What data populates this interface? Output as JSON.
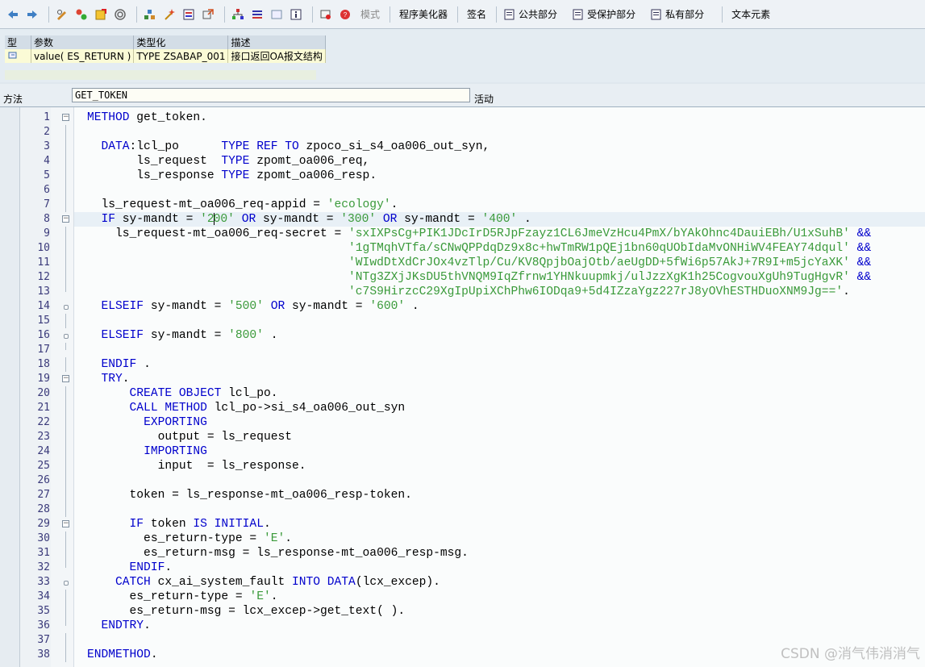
{
  "toolbar": {
    "mode_label": "模式",
    "pretty_printer_label": "程序美化器",
    "signature_label": "签名",
    "public_section_label": "公共部分",
    "protected_section_label": "受保护部分",
    "private_section_label": "私有部分",
    "text_elements_label": "文本元素"
  },
  "params": {
    "headers": [
      "型",
      "参数",
      "类型化",
      "描述"
    ],
    "rows": [
      {
        "param": "value( ES_RETURN )",
        "typing": "TYPE ZSABAP_001",
        "desc": "接口返回OA报文结构"
      }
    ]
  },
  "method_bar": {
    "label": "方法",
    "value": "GET_TOKEN",
    "status": "活动"
  },
  "code_lines": [
    "<span class='k'>METHOD</span> get_token.",
    "",
    "  <span class='k'>DATA</span>:lcl_po      <span class='k'>TYPE REF TO</span> zpoco_si_s4_oa006_out_syn,",
    "       ls_request  <span class='k'>TYPE</span> zpomt_oa006_req,",
    "       ls_response <span class='k'>TYPE</span> zpomt_oa006_resp.",
    "",
    "  ls_request-mt_oa006_req-appid = <span class='s'>'ecology'</span>.",
    "  <span class='k'>IF</span> sy-mandt = <span class='s'>'2<CARET>00'</span> <span class='k'>OR</span> sy-mandt = <span class='s'>'300'</span> <span class='k'>OR</span> sy-mandt = <span class='s'>'400'</span> .",
    "    ls_request-mt_oa006_req-secret = <span class='s'>'sxIXPsCg+PIK1JDcIrD5RJpFzayz1CL6JmeVzHcu4PmX/bYAkOhnc4DauiEBh/U1xSuhB'</span> <span class='k'>&amp;&amp;</span>",
    "                                     <span class='s'>'1gTMqhVTfa/sCNwQPPdqDz9x8c+hwTmRW1pQEj1bn60qUObIdaMvONHiWV4FEAY74dqul'</span> <span class='k'>&amp;&amp;</span>",
    "                                     <span class='s'>'WIwdDtXdCrJOx4vzTlp/Cu/KV8QpjbOajOtb/aeUgDD+5fWi6p57AkJ+7R9I+m5jcYaXK'</span> <span class='k'>&amp;&amp;</span>",
    "                                     <span class='s'>'NTg3ZXjJKsDU5thVNQM9IqZfrnw1YHNkuupmkj/ulJzzXgK1h25CogvouXgUh9TugHgvR'</span> <span class='k'>&amp;&amp;</span>",
    "                                     <span class='s'>'c7S9HirzcC29XgIpUpiXChPhw6IODqa9+5d4IZzaYgz227rJ8yOVhESTHDuoXNM9Jg=='</span>.",
    "  <span class='k'>ELSEIF</span> sy-mandt = <span class='s'>'500'</span> <span class='k'>OR</span> sy-mandt = <span class='s'>'600'</span> .",
    "",
    "  <span class='k'>ELSEIF</span> sy-mandt = <span class='s'>'800'</span> .",
    "",
    "  <span class='k'>ENDIF</span> .",
    "  <span class='k'>TRY</span>.",
    "      <span class='k'>CREATE OBJECT</span> lcl_po.",
    "      <span class='k'>CALL METHOD</span> lcl_po->si_s4_oa006_out_syn",
    "        <span class='k'>EXPORTING</span>",
    "          output = ls_request",
    "        <span class='k'>IMPORTING</span>",
    "          input  = ls_response.",
    "",
    "      token = ls_response-mt_oa006_resp-token.",
    "",
    "      <span class='k'>IF</span> token <span class='k'>IS INITIAL</span>.",
    "        es_return-type = <span class='s'>'E'</span>.",
    "        es_return-msg = ls_response-mt_oa006_resp-msg.",
    "      <span class='k'>ENDIF</span>.",
    "    <span class='k'>CATCH</span> cx_ai_system_fault <span class='k'>INTO DATA</span>(lcx_excep).",
    "      es_return-type = <span class='s'>'E'</span>.",
    "      es_return-msg = lcx_excep->get_text( ).",
    "  <span class='k'>ENDTRY</span>.",
    "",
    "<span class='k'>ENDMETHOD</span>."
  ],
  "watermark": "CSDN @消气伟消消气"
}
